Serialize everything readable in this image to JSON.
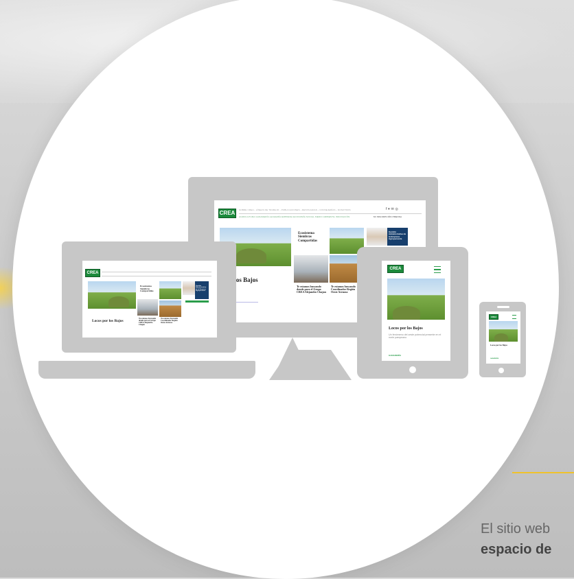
{
  "caption": {
    "line1": "El sitio web",
    "line2": "espacio de"
  },
  "crea_logo": "CREA",
  "desktop": {
    "nav_top": "SOBRE CREA  ›  LÍNEAS DE TRABAJO  ›  PUBLICACIONES  ›  DESTACADAS  ›  CONSEJERÍAS  ›  NOSOTROS",
    "nav_bottom": "AGRICULTURA  GANADERÍA  LECHERÍA  EMPRESA  ECONOMÍA  SOCIAL  MEDIO AMBIENTE  INNOVACIÓN",
    "nav_right": "MI INSCRIPCIÓN  PRENSA",
    "social": "f  ▾  ✉  ◎",
    "hero_title": "s por los Bajos",
    "card1_title": "Ecosistema Siembras Compartidas",
    "card2_title": "Te estamos buscando donde para el Grupo CREA Alejandro Chajan",
    "card3_title": "Te estamos buscando Coordinador Región Oeste Arenoso",
    "blue_card_title": "Gestión Administrativa de la Empresa Agropecuaria"
  },
  "laptop": {
    "hero_title": "Locos por los Bajos",
    "card1_title": "Ecosistema Siembras Compartidas",
    "card2_title": "Te estamos buscando donde para el Grupo CREA Alejandro Chajan",
    "card3_title": "Te estamos buscando Coordinador Región Oeste Arenoso",
    "blue_card_title": "Gestión Administrativa de la Empresa Agropecuaria"
  },
  "tablet": {
    "hero_title": "Locos por los Bajos",
    "hero_text": "Un fenómeno del oeste potencial presente en el norte pampeano",
    "tag": "GANADERÍA"
  },
  "phone": {
    "hero_title": "Locos por los Bajos",
    "tag": "GANADERÍA"
  }
}
